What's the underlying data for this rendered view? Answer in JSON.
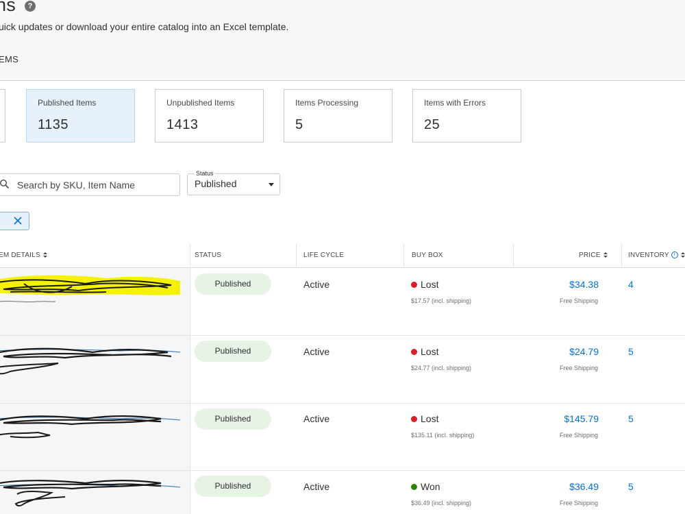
{
  "header": {
    "title": "ns",
    "help_icon": "question-circle-icon",
    "subtitle": "uick updates or download your entire catalog into an Excel template.",
    "tab_label": "EMS"
  },
  "cards": [
    {
      "label": "Published Items",
      "value": "1135",
      "selected": true
    },
    {
      "label": "Unpublished Items",
      "value": "1413",
      "selected": false
    },
    {
      "label": "Items Processing",
      "value": "5",
      "selected": false
    },
    {
      "label": "Items with Errors",
      "value": "25",
      "selected": false
    }
  ],
  "filters": {
    "search_placeholder": "Search by SKU, Item Name",
    "search_icon": "search-icon",
    "status_label": "Status",
    "status_value": "Published",
    "chip_close_icon": "close-icon"
  },
  "table": {
    "headers": {
      "item_details": "EM DETAILS",
      "status": "STATUS",
      "life_cycle": "LIFE CYCLE",
      "buy_box": "BUY BOX",
      "price": "PRICE",
      "inventory": "INVENTORY"
    },
    "rows": [
      {
        "status": "Published",
        "life_cycle": "Active",
        "buy_box": "Lost",
        "buy_box_state": "lost",
        "buy_box_price": "$17.57 (incl. shipping)",
        "price": "$34.38",
        "shipping": "Free Shipping",
        "inventory": "4"
      },
      {
        "status": "Published",
        "life_cycle": "Active",
        "buy_box": "Lost",
        "buy_box_state": "lost",
        "buy_box_price": "$24.77 (incl. shipping)",
        "price": "$24.79",
        "shipping": "Free Shipping",
        "inventory": "5"
      },
      {
        "status": "Published",
        "life_cycle": "Active",
        "buy_box": "Lost",
        "buy_box_state": "lost",
        "buy_box_price": "$135.11 (incl. shipping)",
        "price": "$145.79",
        "shipping": "Free Shipping",
        "inventory": "5"
      },
      {
        "status": "Published",
        "life_cycle": "Active",
        "buy_box": "Won",
        "buy_box_state": "won",
        "buy_box_price": "$36.49 (incl. shipping)",
        "price": "$36.49",
        "shipping": "Free Shipping",
        "inventory": "5"
      }
    ]
  },
  "colors": {
    "accent_blue": "#0071dc",
    "lost_red": "#de1c24",
    "won_green": "#2a8703",
    "published_badge_bg": "#e7f3e5",
    "selected_card_bg": "#e6f1fc",
    "highlight_yellow": "#f4f200"
  }
}
